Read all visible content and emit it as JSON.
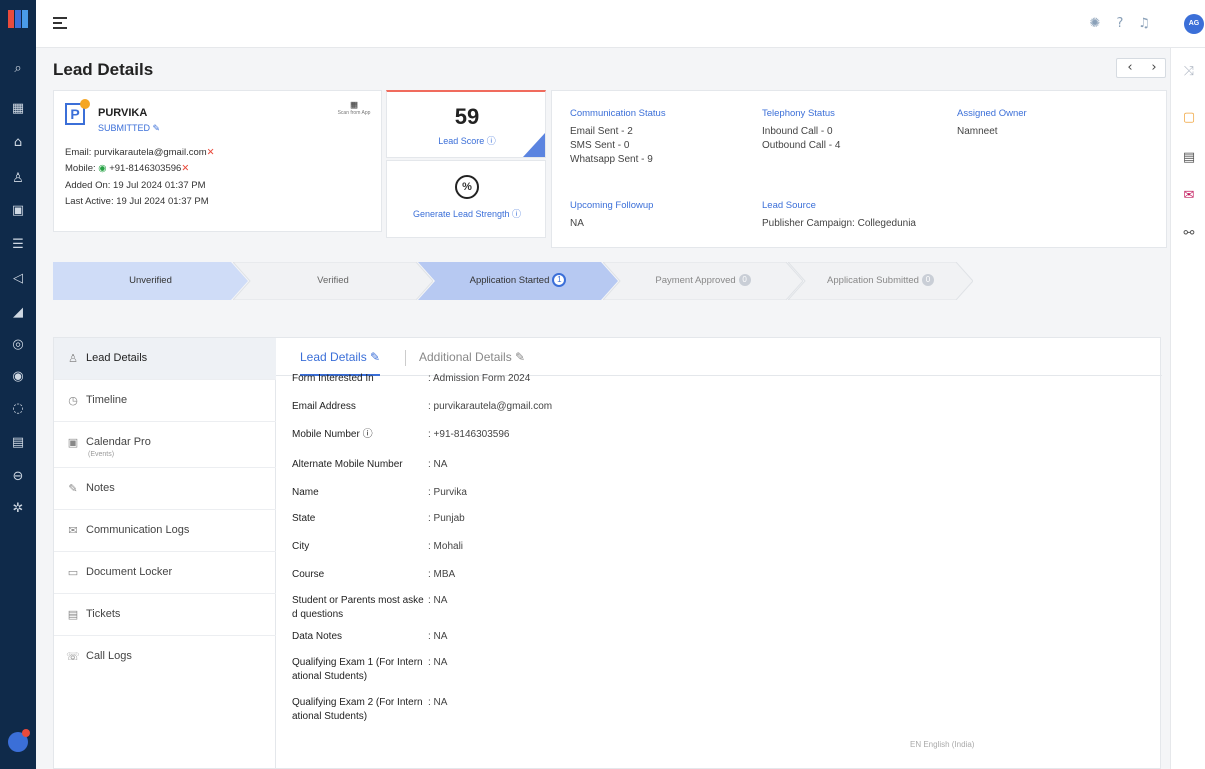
{
  "header": {
    "title": "Lead Details",
    "prev": "‹",
    "next": "›",
    "avatar_initials": "AG"
  },
  "lead": {
    "initial": "P",
    "name": "PURVIKA",
    "status": "SUBMITTED ✎",
    "qr_icon": "▦",
    "qr_label": "Scan from App",
    "email_label": "Email:",
    "email": "purvikarautela@gmail.com",
    "mobile_label": "Mobile:",
    "mobile": "+91-8146303596",
    "added_on": "Added On: 19 Jul 2024 01:37 PM",
    "last_active": "Last Active: 19 Jul 2024 01:37 PM"
  },
  "score": {
    "value": "59",
    "label": "Lead Score ⓘ",
    "strength_icon": "%",
    "strength_label": "Generate Lead Strength ⓘ"
  },
  "communication": {
    "heading": "Communication Status",
    "items": [
      "Email Sent - 2",
      "SMS Sent - 0",
      "Whatsapp Sent - 9"
    ],
    "followup_heading": "Upcoming Followup",
    "followup_value": "NA"
  },
  "telephony": {
    "heading": "Telephony Status",
    "items": [
      "Inbound Call - 0",
      "Outbound Call - 4"
    ],
    "source_heading": "Lead Source",
    "source_value": "Publisher Campaign: Collegedunia"
  },
  "owner": {
    "heading": "Assigned Owner",
    "value": "Namneet"
  },
  "stages": [
    {
      "label": "Unverified",
      "count": ""
    },
    {
      "label": "Verified",
      "count": ""
    },
    {
      "label": "Application Started",
      "count": "1"
    },
    {
      "label": "Payment Approved",
      "count": "0"
    },
    {
      "label": "Application Submitted",
      "count": "0"
    }
  ],
  "sidebar": {
    "items": [
      {
        "label": "Lead Details",
        "icon": "user-icon",
        "sub": ""
      },
      {
        "label": "Timeline",
        "icon": "clock-icon",
        "sub": ""
      },
      {
        "label": "Calendar Pro",
        "icon": "calendar-icon",
        "sub": "(Events)"
      },
      {
        "label": "Notes",
        "icon": "edit-icon",
        "sub": ""
      },
      {
        "label": "Communication Logs",
        "icon": "mail-icon",
        "sub": ""
      },
      {
        "label": "Document Locker",
        "icon": "folder-icon",
        "sub": ""
      },
      {
        "label": "Tickets",
        "icon": "ticket-icon",
        "sub": ""
      },
      {
        "label": "Call Logs",
        "icon": "phone-icon",
        "sub": ""
      }
    ]
  },
  "tabs": [
    "Lead Details ✎",
    "Additional Details ✎"
  ],
  "details": [
    {
      "key": "Form Interested In",
      "value": ": Admission Form 2024"
    },
    {
      "key": "Email Address",
      "value": ": purvikarautela@gmail.com"
    },
    {
      "key": "Mobile Number ⓘ",
      "value": ": +91-8146303596"
    },
    {
      "key": "Alternate Mobile Number",
      "value": ": NA"
    },
    {
      "key": "Name",
      "value": ": Purvika"
    },
    {
      "key": "State",
      "value": ": Punjab"
    },
    {
      "key": "City",
      "value": ": Mohali"
    },
    {
      "key": "Course",
      "value": ": MBA"
    },
    {
      "key": "Student or Parents most aske d questions",
      "value": ": NA"
    },
    {
      "key": "Data Notes",
      "value": ": NA"
    },
    {
      "key": "Qualifying Exam 1 (For Intern ational Students)",
      "value": ": NA"
    },
    {
      "key": "Qualifying Exam 2 (For Intern ational Students)",
      "value": ": NA"
    }
  ],
  "footer": {
    "language": "EN English (India)"
  },
  "colors": {
    "nav_bg": "#0f2a4a",
    "accent": "#3b6fd8",
    "stage_done": "#cfdcf7",
    "stage_active": "#b7c9f2",
    "stage_pending": "#f1f2f4"
  }
}
